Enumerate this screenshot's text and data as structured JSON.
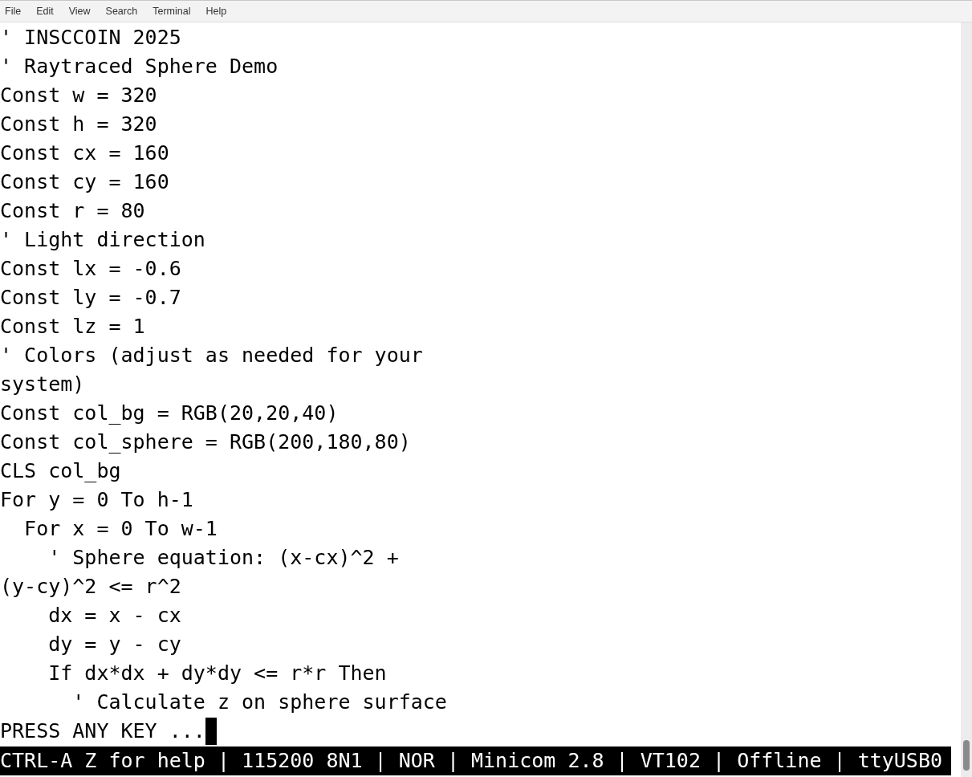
{
  "menu_bar": [
    "File",
    "Edit",
    "View",
    "Search",
    "Terminal",
    "Help"
  ],
  "terminal": {
    "lines": [
      "' INSCCOIN 2025",
      "' Raytraced Sphere Demo",
      "Const w = 320",
      "Const h = 320",
      "Const cx = 160",
      "Const cy = 160",
      "Const r = 80",
      "' Light direction",
      "Const lx = -0.6",
      "Const ly = -0.7",
      "Const lz = 1",
      "' Colors (adjust as needed for your",
      "system)",
      "Const col_bg = RGB(20,20,40)",
      "Const col_sphere = RGB(200,180,80)",
      "CLS col_bg",
      "For y = 0 To h-1",
      "  For x = 0 To w-1",
      "    ' Sphere equation: (x-cx)^2 +",
      "(y-cy)^2 <= r^2",
      "    dx = x - cx",
      "    dy = y - cy",
      "    If dx*dx + dy*dy <= r*r Then",
      "      ' Calculate z on sphere surface",
      "PRESS ANY KEY ..."
    ],
    "cursor_visible": true,
    "status_line": "CTRL-A Z for help | 115200 8N1 | NOR | Minicom 2.8 | VT102 | Offline | ttyUSB0"
  }
}
